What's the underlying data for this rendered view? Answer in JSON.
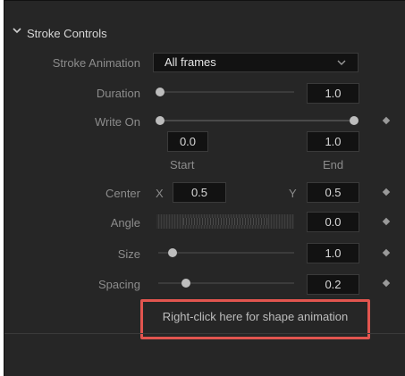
{
  "section": {
    "title": "Stroke Controls"
  },
  "stroke_animation": {
    "label": "Stroke Animation",
    "value": "All frames"
  },
  "duration": {
    "label": "Duration",
    "value": "1.0"
  },
  "write_on": {
    "label": "Write On",
    "start_value": "0.0",
    "end_value": "1.0",
    "start_label": "Start",
    "end_label": "End"
  },
  "center": {
    "label": "Center",
    "x_label": "X",
    "x_value": "0.5",
    "y_label": "Y",
    "y_value": "0.5"
  },
  "angle": {
    "label": "Angle",
    "value": "0.0"
  },
  "size": {
    "label": "Size",
    "value": "1.0"
  },
  "spacing": {
    "label": "Spacing",
    "value": "0.2"
  },
  "context_hint": {
    "text": "Right-click here for shape animation"
  },
  "colors": {
    "panel_bg": "#262626",
    "field_bg": "#121212",
    "highlight": "#e2554f"
  }
}
